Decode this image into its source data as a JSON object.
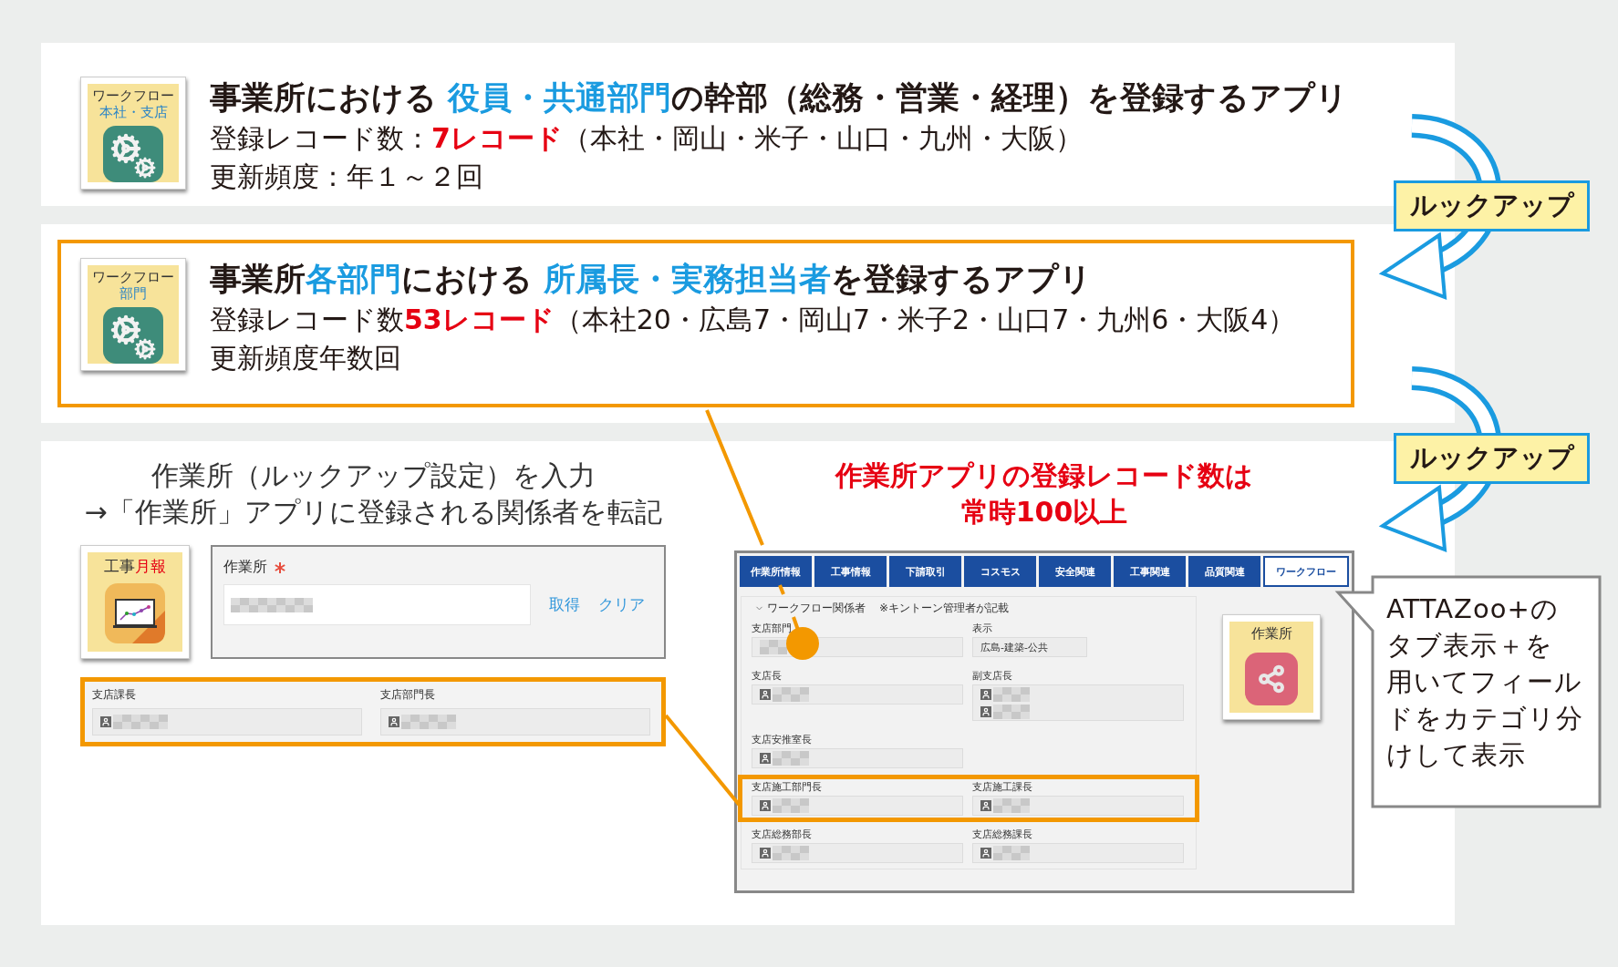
{
  "apps": [
    {
      "icon": {
        "line1": "ワークフロー",
        "line2": "本社・支店"
      },
      "title": "事業所における **役員・共通部門**の幹部（総務・営業・経理）を登録するアプリ",
      "lines": [
        "登録レコード数：**7レコード**（本社・岡山・米子・山口・九州・大阪）",
        "更新頻度：年１～２回"
      ],
      "highlighted": false
    },
    {
      "icon": {
        "line1": "ワークフロー",
        "line2": "部門"
      },
      "title": "事業所**各部門**における **所属長・実務担当者**を登録するアプリ",
      "lines": [
        "登録レコード数**53レコード**（本社20・広島7・岡山7・米子2・山口7・九州6・大阪4）",
        "更新頻度年数回"
      ],
      "highlighted": true
    }
  ],
  "lookup_labels": [
    "ルックアップ",
    "ルックアップ"
  ],
  "lookup_form": {
    "heading": [
      "作業所（ルックアップ設定）を入力",
      "→「作業所」アプリに登録される関係者を転記"
    ],
    "app_icon": {
      "label": "工事**月報**"
    },
    "field": {
      "label": "作業所",
      "required": true,
      "actions": [
        "取得",
        "クリア"
      ]
    },
    "copied_fields": [
      {
        "label": "支店課長"
      },
      {
        "label": "支店部門長"
      }
    ],
    "highlighted": true
  },
  "record_note": [
    "作業所アプリの登録レコード数は",
    "常時100以上"
  ],
  "screen": {
    "tabs": [
      {
        "label": "作業所情報",
        "selected": false
      },
      {
        "label": "工事情報",
        "selected": false
      },
      {
        "label": "下請取引",
        "selected": false
      },
      {
        "label": "コスモス",
        "selected": false
      },
      {
        "label": "安全関連",
        "selected": false
      },
      {
        "label": "工事関連",
        "selected": false
      },
      {
        "label": "品質関連",
        "selected": false
      },
      {
        "label": "ワークフロー",
        "selected": true
      }
    ],
    "section": {
      "title": "ワークフロー関係者",
      "note": "※キントーン管理者が記載",
      "expanded": true
    },
    "rows": [
      {
        "highlighted": false,
        "fields": [
          {
            "label": "支店部門",
            "kind": "mosaic"
          },
          {
            "label": "表示",
            "kind": "text",
            "value": "広島-建築-公共"
          }
        ]
      },
      {
        "highlighted": false,
        "fields": [
          {
            "label": "支店長",
            "kind": "user"
          },
          {
            "label": "副支店長",
            "kind": "user-pair"
          }
        ]
      },
      {
        "highlighted": false,
        "fields": [
          {
            "label": "支店安推室長",
            "kind": "user"
          }
        ]
      },
      {
        "highlighted": true,
        "fields": [
          {
            "label": "支店施工部門長",
            "kind": "user"
          },
          {
            "label": "支店施工課長",
            "kind": "user"
          }
        ]
      },
      {
        "highlighted": false,
        "fields": [
          {
            "label": "支店総務部長",
            "kind": "user"
          },
          {
            "label": "支店総務課長",
            "kind": "user"
          }
        ]
      }
    ],
    "app_icon": {
      "label": "作業所"
    }
  },
  "callout": [
    "ATTAZoo+の",
    "タブ表示＋を",
    "用いてフィール",
    "ドをカテゴリ分",
    "けして表示"
  ]
}
